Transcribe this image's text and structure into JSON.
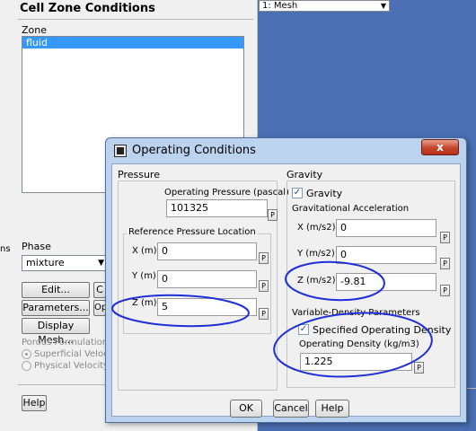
{
  "colors": {
    "graphics_bg": "#4b6fb3",
    "dialog_frame": "#bcd3f0",
    "selection": "#3399ff",
    "annotation": "#1f2fd6"
  },
  "cell_zone": {
    "title": "Cell Zone Conditions",
    "zone_label": "Zone",
    "zones": [
      "fluid"
    ],
    "left_cut": "ns",
    "phase_label": "Phase",
    "phase_value": "mixture",
    "edit_label": "Edit...",
    "copy_cut": "C",
    "parameters_label": "Parameters...",
    "op_cut": "Op",
    "display_mesh_label": "Display Mesh...",
    "porous_title": "Porous Formulation",
    "porous_options": [
      "Superficial Velocity",
      "Physical Velocity"
    ],
    "help_label": "Help"
  },
  "graphics": {
    "view_select": "1: Mesh"
  },
  "dialog": {
    "title": "Operating Conditions",
    "close_glyph": "x",
    "pressure": {
      "group_title": "Pressure",
      "op_pressure_label": "Operating Pressure (pascal)",
      "op_pressure_value": "101325",
      "ref_location_title": "Reference Pressure Location",
      "x_label": "X (m)",
      "x_value": "0",
      "y_label": "Y (m)",
      "y_value": "0",
      "z_label": "Z (m)",
      "z_value": "5"
    },
    "gravity": {
      "group_title": "Gravity",
      "gravity_check_label": "Gravity",
      "accel_title": "Gravitational Acceleration",
      "x_label": "X (m/s2)",
      "x_value": "0",
      "y_label": "Y (m/s2)",
      "y_value": "0",
      "z_label": "Z (m/s2)",
      "z_value": "-9.81"
    },
    "variable_density": {
      "group_title": "Variable-Density Parameters",
      "specified_check_label": "Specified Operating Density",
      "density_label": "Operating Density (kg/m3)",
      "density_value": "1.225"
    },
    "p_glyph": "P",
    "buttons": {
      "ok": "OK",
      "cancel": "Cancel",
      "help": "Help"
    }
  }
}
